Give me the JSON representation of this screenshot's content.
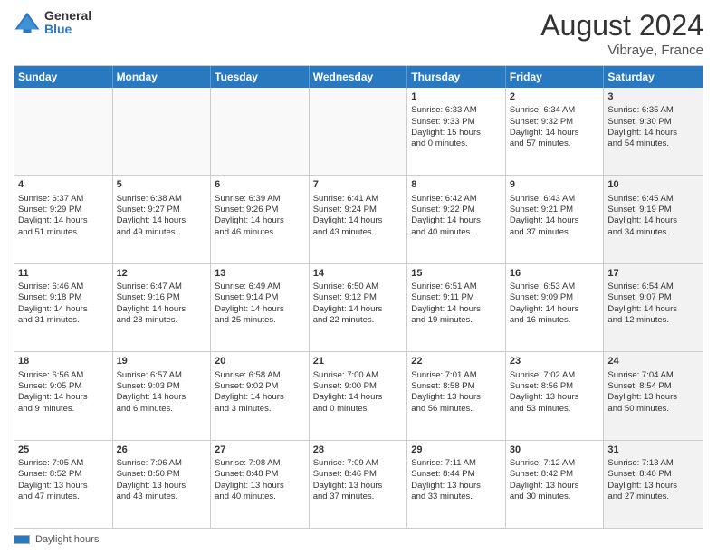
{
  "header": {
    "logo_general": "General",
    "logo_blue": "Blue",
    "month_title": "August 2024",
    "location": "Vibraye, France"
  },
  "days_of_week": [
    "Sunday",
    "Monday",
    "Tuesday",
    "Wednesday",
    "Thursday",
    "Friday",
    "Saturday"
  ],
  "footer": {
    "label": "Daylight hours"
  },
  "weeks": [
    {
      "cells": [
        {
          "day": "",
          "empty": true
        },
        {
          "day": "",
          "empty": true
        },
        {
          "day": "",
          "empty": true
        },
        {
          "day": "",
          "empty": true
        },
        {
          "day": "1",
          "info": "Sunrise: 6:33 AM\nSunset: 9:33 PM\nDaylight: 15 hours\nand 0 minutes."
        },
        {
          "day": "2",
          "info": "Sunrise: 6:34 AM\nSunset: 9:32 PM\nDaylight: 14 hours\nand 57 minutes."
        },
        {
          "day": "3",
          "info": "Sunrise: 6:35 AM\nSunset: 9:30 PM\nDaylight: 14 hours\nand 54 minutes.",
          "shaded": true
        }
      ]
    },
    {
      "cells": [
        {
          "day": "4",
          "info": "Sunrise: 6:37 AM\nSunset: 9:29 PM\nDaylight: 14 hours\nand 51 minutes."
        },
        {
          "day": "5",
          "info": "Sunrise: 6:38 AM\nSunset: 9:27 PM\nDaylight: 14 hours\nand 49 minutes."
        },
        {
          "day": "6",
          "info": "Sunrise: 6:39 AM\nSunset: 9:26 PM\nDaylight: 14 hours\nand 46 minutes."
        },
        {
          "day": "7",
          "info": "Sunrise: 6:41 AM\nSunset: 9:24 PM\nDaylight: 14 hours\nand 43 minutes."
        },
        {
          "day": "8",
          "info": "Sunrise: 6:42 AM\nSunset: 9:22 PM\nDaylight: 14 hours\nand 40 minutes."
        },
        {
          "day": "9",
          "info": "Sunrise: 6:43 AM\nSunset: 9:21 PM\nDaylight: 14 hours\nand 37 minutes."
        },
        {
          "day": "10",
          "info": "Sunrise: 6:45 AM\nSunset: 9:19 PM\nDaylight: 14 hours\nand 34 minutes.",
          "shaded": true
        }
      ]
    },
    {
      "cells": [
        {
          "day": "11",
          "info": "Sunrise: 6:46 AM\nSunset: 9:18 PM\nDaylight: 14 hours\nand 31 minutes."
        },
        {
          "day": "12",
          "info": "Sunrise: 6:47 AM\nSunset: 9:16 PM\nDaylight: 14 hours\nand 28 minutes."
        },
        {
          "day": "13",
          "info": "Sunrise: 6:49 AM\nSunset: 9:14 PM\nDaylight: 14 hours\nand 25 minutes."
        },
        {
          "day": "14",
          "info": "Sunrise: 6:50 AM\nSunset: 9:12 PM\nDaylight: 14 hours\nand 22 minutes."
        },
        {
          "day": "15",
          "info": "Sunrise: 6:51 AM\nSunset: 9:11 PM\nDaylight: 14 hours\nand 19 minutes."
        },
        {
          "day": "16",
          "info": "Sunrise: 6:53 AM\nSunset: 9:09 PM\nDaylight: 14 hours\nand 16 minutes."
        },
        {
          "day": "17",
          "info": "Sunrise: 6:54 AM\nSunset: 9:07 PM\nDaylight: 14 hours\nand 12 minutes.",
          "shaded": true
        }
      ]
    },
    {
      "cells": [
        {
          "day": "18",
          "info": "Sunrise: 6:56 AM\nSunset: 9:05 PM\nDaylight: 14 hours\nand 9 minutes."
        },
        {
          "day": "19",
          "info": "Sunrise: 6:57 AM\nSunset: 9:03 PM\nDaylight: 14 hours\nand 6 minutes."
        },
        {
          "day": "20",
          "info": "Sunrise: 6:58 AM\nSunset: 9:02 PM\nDaylight: 14 hours\nand 3 minutes."
        },
        {
          "day": "21",
          "info": "Sunrise: 7:00 AM\nSunset: 9:00 PM\nDaylight: 14 hours\nand 0 minutes."
        },
        {
          "day": "22",
          "info": "Sunrise: 7:01 AM\nSunset: 8:58 PM\nDaylight: 13 hours\nand 56 minutes."
        },
        {
          "day": "23",
          "info": "Sunrise: 7:02 AM\nSunset: 8:56 PM\nDaylight: 13 hours\nand 53 minutes."
        },
        {
          "day": "24",
          "info": "Sunrise: 7:04 AM\nSunset: 8:54 PM\nDaylight: 13 hours\nand 50 minutes.",
          "shaded": true
        }
      ]
    },
    {
      "cells": [
        {
          "day": "25",
          "info": "Sunrise: 7:05 AM\nSunset: 8:52 PM\nDaylight: 13 hours\nand 47 minutes."
        },
        {
          "day": "26",
          "info": "Sunrise: 7:06 AM\nSunset: 8:50 PM\nDaylight: 13 hours\nand 43 minutes."
        },
        {
          "day": "27",
          "info": "Sunrise: 7:08 AM\nSunset: 8:48 PM\nDaylight: 13 hours\nand 40 minutes."
        },
        {
          "day": "28",
          "info": "Sunrise: 7:09 AM\nSunset: 8:46 PM\nDaylight: 13 hours\nand 37 minutes."
        },
        {
          "day": "29",
          "info": "Sunrise: 7:11 AM\nSunset: 8:44 PM\nDaylight: 13 hours\nand 33 minutes."
        },
        {
          "day": "30",
          "info": "Sunrise: 7:12 AM\nSunset: 8:42 PM\nDaylight: 13 hours\nand 30 minutes."
        },
        {
          "day": "31",
          "info": "Sunrise: 7:13 AM\nSunset: 8:40 PM\nDaylight: 13 hours\nand 27 minutes.",
          "shaded": true
        }
      ]
    }
  ]
}
